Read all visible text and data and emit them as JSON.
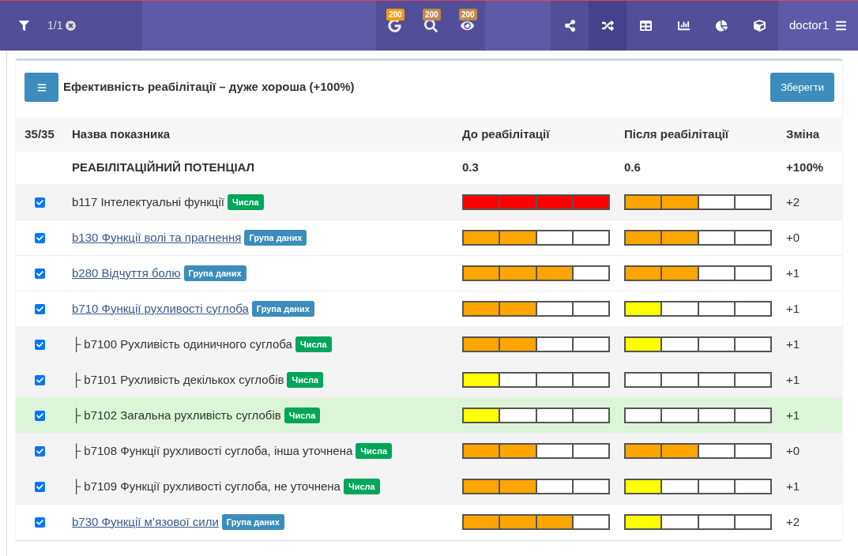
{
  "topbar": {
    "filter_count": "1/1",
    "badges": [
      {
        "count": "200",
        "color": "#f39c12"
      },
      {
        "count": "200",
        "color": "#c08a4c"
      },
      {
        "count": "200",
        "color": "#c08a4c"
      }
    ],
    "views": [
      {
        "selected": false
      },
      {
        "selected": true
      },
      {
        "selected": false
      },
      {
        "selected": false
      },
      {
        "selected": false
      },
      {
        "selected": false
      }
    ],
    "user": "doctor1"
  },
  "card": {
    "title": "Ефективність реабілітації – дуже хороша (+100%)",
    "save": "Зберегти"
  },
  "table": {
    "columns": [
      "35/35",
      "Назва показника",
      "До реабілітації",
      "Після реабілітації",
      "Зміна"
    ],
    "summary": {
      "name": "РЕАБІЛІТАЦІЙНИЙ ПОТЕНЦІАЛ",
      "before": "0.3",
      "after": "0.6",
      "change": "+100%"
    },
    "rows": [
      {
        "kind": "numbers",
        "checked": true,
        "selected": false,
        "name": "b117 Інтелектуальні функції",
        "tag": "Числа",
        "before": {
          "level": 1,
          "color": "#ff0000"
        },
        "after": {
          "level": 0.5,
          "color": "#ffa500"
        },
        "change": "+2"
      },
      {
        "kind": "group",
        "checked": true,
        "selected": false,
        "name": "b130 Функції волі та прагнення",
        "tag": "Група даних",
        "before": {
          "level": 0.5,
          "color": "#ffa500"
        },
        "after": {
          "level": 0.5,
          "color": "#ffa500"
        },
        "change": "+0"
      },
      {
        "kind": "group",
        "checked": true,
        "selected": false,
        "name": "b280 Відчуття болю",
        "tag": "Група даних",
        "before": {
          "level": 0.75,
          "color": "#ffa500"
        },
        "after": {
          "level": 0.5,
          "color": "#ffa500"
        },
        "change": "+1"
      },
      {
        "kind": "group",
        "checked": true,
        "selected": false,
        "name": "b710 Функції рухливості суглоба",
        "tag": "Група даних",
        "before": {
          "level": 0.5,
          "color": "#ffa500"
        },
        "after": {
          "level": 0.25,
          "color": "#ffff00"
        },
        "change": "+1",
        "children": [
          {
            "kind": "numbers",
            "prefix": "├",
            "checked": true,
            "selected": false,
            "name": "b7100 Рухливість одиничного суглоба",
            "tag": "Числа",
            "before": {
              "level": 0.5,
              "color": "#ffa500"
            },
            "after": {
              "level": 0.25,
              "color": "#ffff00"
            },
            "change": "+1"
          },
          {
            "kind": "numbers",
            "prefix": "├",
            "checked": true,
            "selected": false,
            "name": "b7101 Рухливість декількох суглобів",
            "tag": "Числа",
            "before": {
              "level": 0.25,
              "color": "#ffff00"
            },
            "change": "+1"
          },
          {
            "kind": "numbers",
            "prefix": "├",
            "checked": true,
            "selected": true,
            "name": "b7102 Загальна рухливість суглобів",
            "tag": "Числа",
            "before": {
              "level": 0.25,
              "color": "#ffff00"
            },
            "change": "+1"
          },
          {
            "kind": "numbers",
            "prefix": "├",
            "checked": true,
            "selected": false,
            "name": "b7108 Функції рухливості суглоба, інша уточнена",
            "tag": "Числа",
            "before": {
              "level": 0.5,
              "color": "#ffa500"
            },
            "after": {
              "level": 0.5,
              "color": "#ffa500"
            },
            "change": "+0"
          },
          {
            "kind": "numbers",
            "prefix": "├",
            "checked": true,
            "selected": false,
            "name": "b7109 Функції рухливості суглоба, не уточнена",
            "tag": "Числа",
            "before": {
              "level": 0.5,
              "color": "#ffa500"
            },
            "after": {
              "level": 0.25,
              "color": "#ffff00"
            },
            "change": "+1"
          }
        ]
      },
      {
        "kind": "group",
        "checked": true,
        "selected": false,
        "name": "b730 Функції м’язової сили",
        "tag": "Група даних",
        "before": {
          "level": 0.75,
          "color": "#ffa500"
        },
        "after": {
          "level": 0.25,
          "color": "#ffff00"
        },
        "change": "+2"
      }
    ]
  }
}
